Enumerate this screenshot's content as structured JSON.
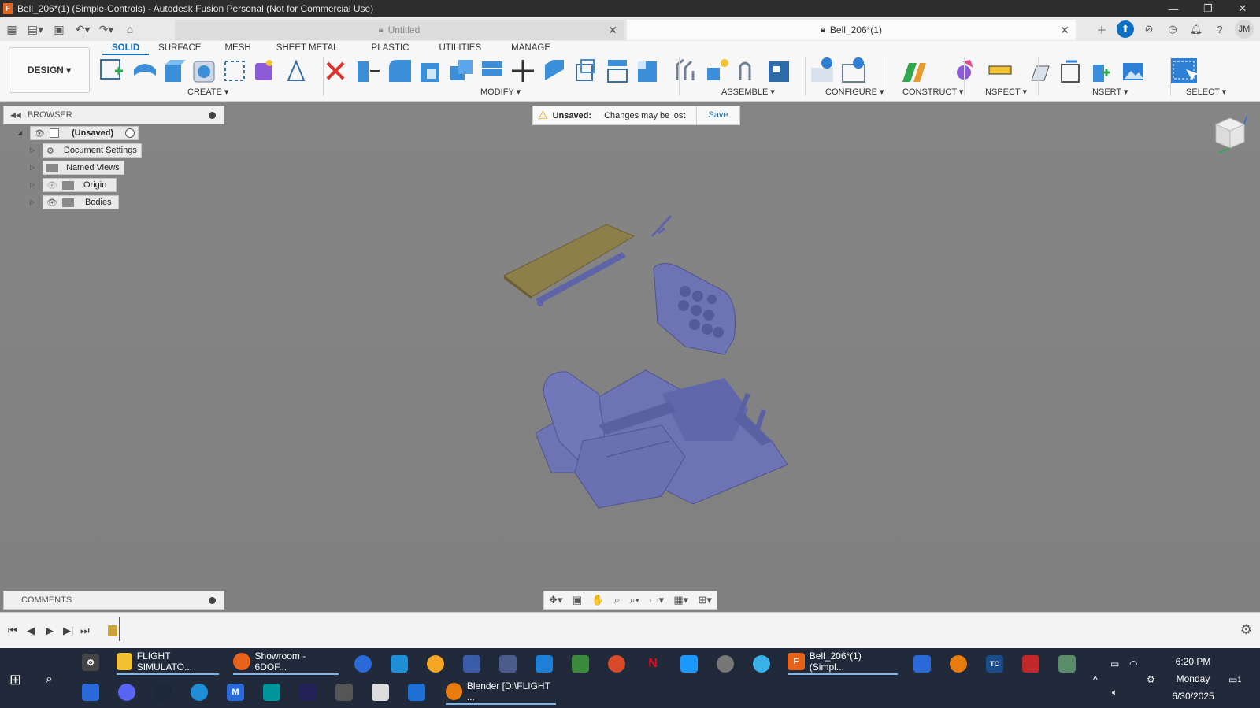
{
  "window": {
    "title": "Bell_206*(1) (Simple-Controls) - Autodesk Fusion Personal (Not for Commercial Use)",
    "controls": [
      "—",
      "❐",
      "✕"
    ]
  },
  "tabs": {
    "inactive_label": "Untitled",
    "active_label": "Bell_206*(1)",
    "user_initials": "JM"
  },
  "ribbon": {
    "workspace": "DESIGN ▾",
    "tabs": [
      "SOLID",
      "SURFACE",
      "MESH",
      "SHEET METAL",
      "PLASTIC",
      "UTILITIES",
      "MANAGE"
    ],
    "groups": {
      "create": "CREATE ▾",
      "modify": "MODIFY ▾",
      "assemble": "ASSEMBLE ▾",
      "configure": "CONFIGURE ▾",
      "construct": "CONSTRUCT ▾",
      "inspect": "INSPECT ▾",
      "insert": "INSERT ▾",
      "select": "SELECT ▾"
    },
    "accent": "#0c6fc4"
  },
  "browser": {
    "title": "BROWSER",
    "root": "(Unsaved)",
    "items": [
      "Document Settings",
      "Named Views",
      "Origin",
      "Bodies"
    ]
  },
  "banner": {
    "label": "Unsaved:",
    "message": "Changes may be lost",
    "action": "Save"
  },
  "comments": {
    "title": "COMMENTS"
  },
  "taskbar": {
    "row1": [
      {
        "label": "FLIGHT SIMULATO...",
        "icon": "folder-icon"
      },
      {
        "label": "Showroom - 6DOF...",
        "icon": "firefox-icon"
      },
      {
        "label": "Bell_206*(1) (Simpl...",
        "icon": "fusion-icon"
      }
    ],
    "row2": [
      {
        "label": "Blender [D:\\FLIGHT ...",
        "icon": "blender-icon"
      }
    ],
    "time": "6:20 PM",
    "day": "Monday",
    "date": "6/30/2025",
    "notification_count": "1"
  },
  "colors": {
    "model_body": "#6d73b3",
    "panel_board": "#8c7f4a",
    "viewport_bg": "#808080"
  }
}
